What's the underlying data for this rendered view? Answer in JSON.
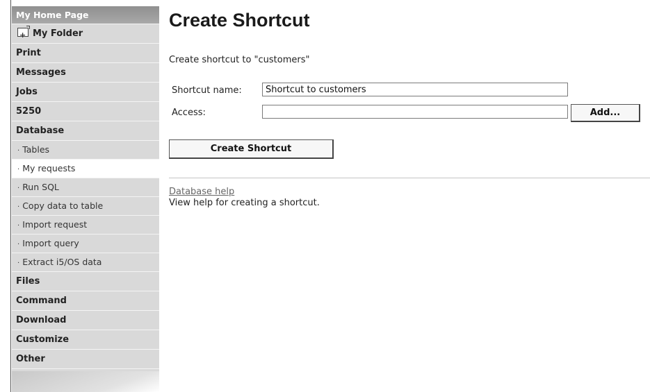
{
  "sidebar": {
    "home": "My Home Page",
    "my_folder": "My Folder",
    "items": [
      "Print",
      "Messages",
      "Jobs",
      "5250",
      "Database"
    ],
    "database_sub": [
      "Tables",
      "My requests",
      "Run SQL",
      "Copy data to table",
      "Import request",
      "Import query",
      "Extract i5/OS data"
    ],
    "bottom_items": [
      "Files",
      "Command",
      "Download",
      "Customize",
      "Other"
    ],
    "bullet": "·"
  },
  "main": {
    "title": "Create Shortcut",
    "subtitle": "Create shortcut to \"customers\"",
    "shortcut_name_label": "Shortcut name:",
    "shortcut_name_value": "Shortcut to customers",
    "access_label": "Access:",
    "access_value": "",
    "add_button": "Add...",
    "create_button": "Create Shortcut",
    "help_link": "Database help",
    "help_text": "View help for creating a shortcut."
  }
}
